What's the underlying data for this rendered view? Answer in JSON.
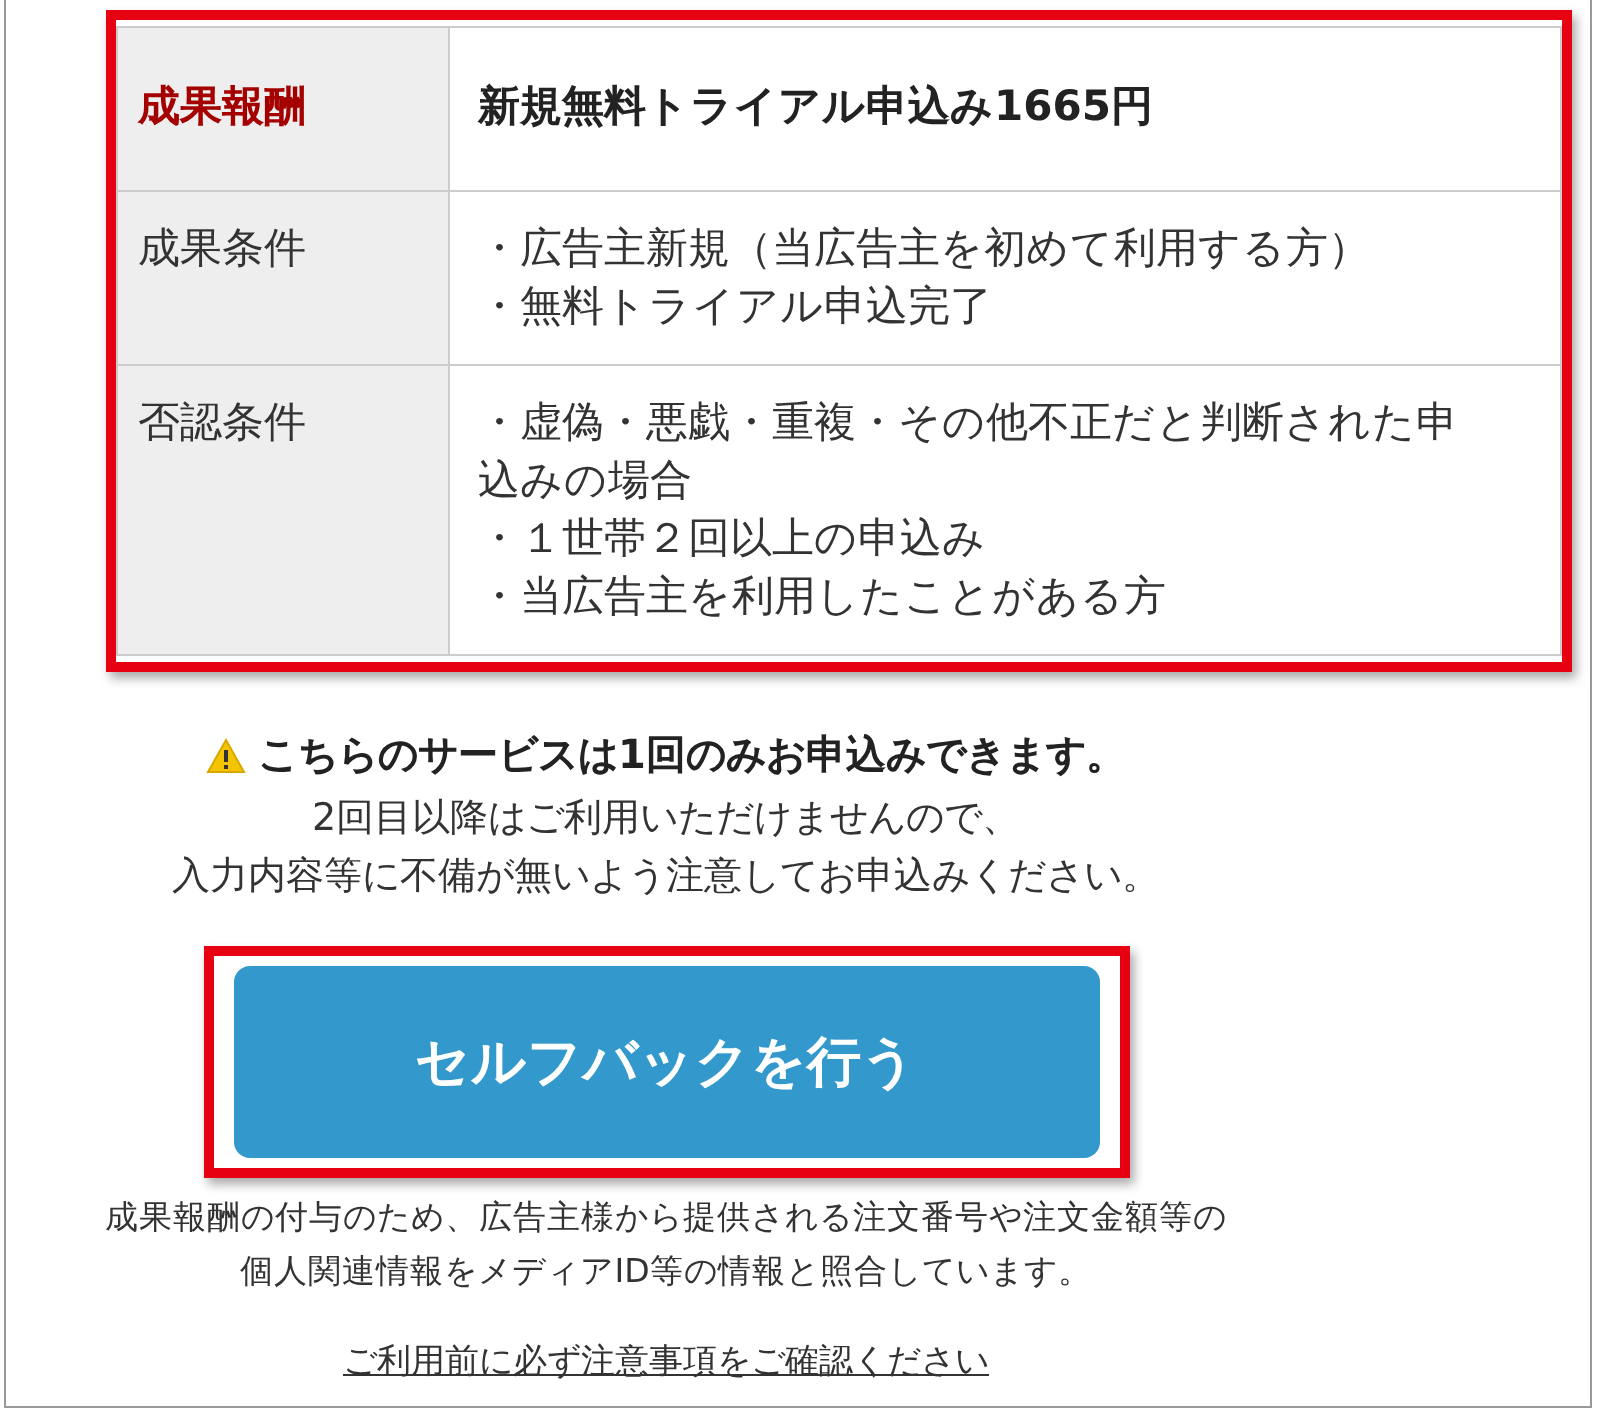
{
  "reward_table": {
    "highlighted": true,
    "rows": [
      {
        "kind": "reward",
        "label": "成果報酬",
        "lines": [
          "新規無料トライアル申込み1665円"
        ]
      },
      {
        "kind": "condition",
        "label": "成果条件",
        "lines": [
          "・広告主新規（当広告主を初めて利用する方）",
          "・無料トライアル申込完了"
        ]
      },
      {
        "kind": "condition",
        "label": "否認条件",
        "lines": [
          "・虚偽・悪戯・重複・その他不正だと判断された申込みの場合",
          "・１世帯２回以上の申込み",
          "・当広告主を利用したことがある方"
        ]
      }
    ]
  },
  "notice": {
    "title": "こちらのサービスは1回のみお申込みできます。",
    "lines": [
      "2回目以降はご利用いただけませんので、",
      "入力内容等に不備が無いよう注意してお申込みください。"
    ]
  },
  "action_button": {
    "label": "セルフバックを行う",
    "highlighted": true
  },
  "disclosure": [
    "成果報酬の付与のため、広告主様から提供される注文番号や注文金額等の",
    "個人関連情報をメディアID等の情報と照合しています。"
  ],
  "link": "ご利用前に必ず注意事項をご確認ください"
}
